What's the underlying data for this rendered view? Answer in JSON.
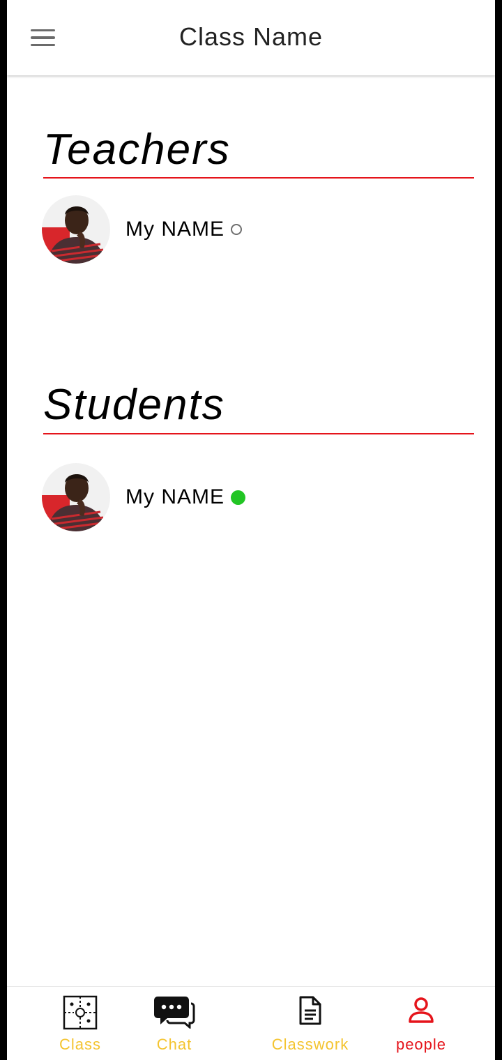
{
  "header": {
    "title": "Class Name",
    "menu_icon": "hamburger-menu-icon"
  },
  "sections": {
    "teachers": {
      "title": "Teachers",
      "people": [
        {
          "name": "My NAME",
          "status": "offline"
        }
      ]
    },
    "students": {
      "title": "Students",
      "people": [
        {
          "name": "My NAME",
          "status": "online"
        }
      ]
    }
  },
  "bottom_nav": {
    "items": [
      {
        "label": "Class",
        "icon": "puzzle-icon",
        "active": false
      },
      {
        "label": "Chat",
        "icon": "chat-bubbles-icon",
        "active": false
      },
      {
        "label": "Classwork",
        "icon": "document-icon",
        "active": false
      },
      {
        "label": "people",
        "icon": "person-icon",
        "active": true
      }
    ]
  },
  "colors": {
    "accent": "#e5141b",
    "inactive_nav": "#f4c430",
    "online": "#22c524",
    "offline": "#6e6e6e"
  }
}
